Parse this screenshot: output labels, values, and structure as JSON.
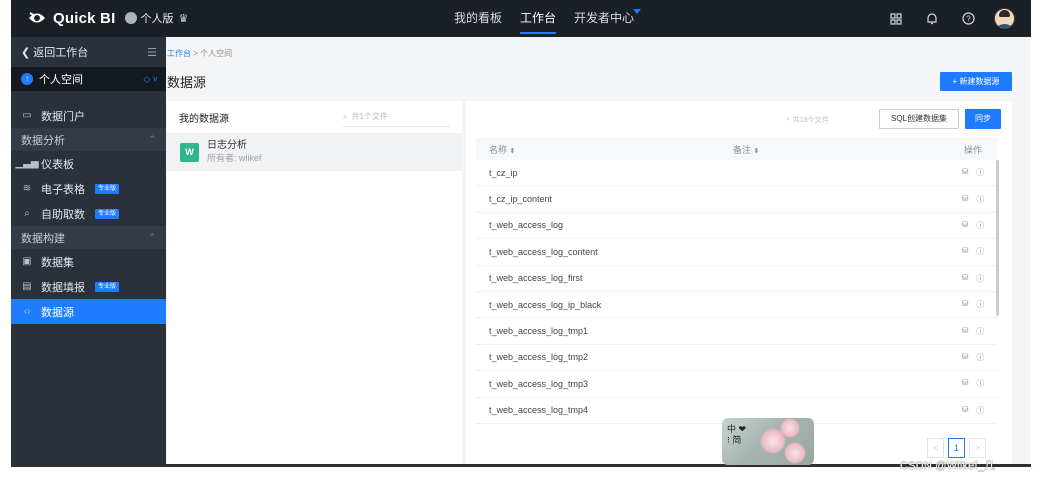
{
  "topbar": {
    "product": "Quick BI",
    "edition": "个人版",
    "nav": [
      {
        "label": "我的看板",
        "active": false
      },
      {
        "label": "工作台",
        "active": true
      },
      {
        "label": "开发者中心",
        "active": false
      }
    ],
    "icons": [
      "grid-icon",
      "bell-icon",
      "help-icon",
      "avatar"
    ]
  },
  "sidebar": {
    "back_label": "返回工作台",
    "space_label": "个人空间",
    "items": [
      {
        "label": "数据门户",
        "icon": "monitor-icon"
      },
      {
        "group": "数据分析"
      },
      {
        "label": "仪表板",
        "icon": "bar-chart-icon"
      },
      {
        "label": "电子表格",
        "icon": "spreadsheet-icon",
        "badge": "专业版"
      },
      {
        "label": "自助取数",
        "icon": "search-data-icon",
        "badge": "专业版"
      },
      {
        "group": "数据构建"
      },
      {
        "label": "数据集",
        "icon": "cube-icon"
      },
      {
        "label": "数据填报",
        "icon": "form-icon",
        "badge": "专业版"
      },
      {
        "label": "数据源",
        "icon": "code-icon",
        "active": true
      }
    ]
  },
  "breadcrumb": {
    "root": "工作台",
    "sep": ">",
    "current": "个人空间"
  },
  "page_title": "数据源",
  "new_button": "+ 新建数据源",
  "left_panel": {
    "title": "我的数据源",
    "search_placeholder": "共1个文件",
    "sources": [
      {
        "badge": "W",
        "name": "日志分析",
        "owner": "所有者: wlikef"
      }
    ]
  },
  "right_panel": {
    "search_placeholder": "共18个文件",
    "sql_button": "SQL创建数据集",
    "sync_button": "同步",
    "columns": {
      "name": "名称",
      "note": "备注",
      "ops": "操作"
    },
    "rows": [
      "t_cz_ip",
      "t_cz_ip_content",
      "t_web_access_log",
      "t_web_access_log_content",
      "t_web_access_log_first",
      "t_web_access_log_ip_black",
      "t_web_access_log_tmp1",
      "t_web_access_log_tmp2",
      "t_web_access_log_tmp3",
      "t_web_access_log_tmp4"
    ]
  },
  "pager": {
    "prev": "<",
    "current": "1",
    "next": ">"
  },
  "ime": {
    "line1": "中 ❤",
    "line2": "⁝ 简"
  },
  "watermark": "CSDN @Wlikef_几"
}
